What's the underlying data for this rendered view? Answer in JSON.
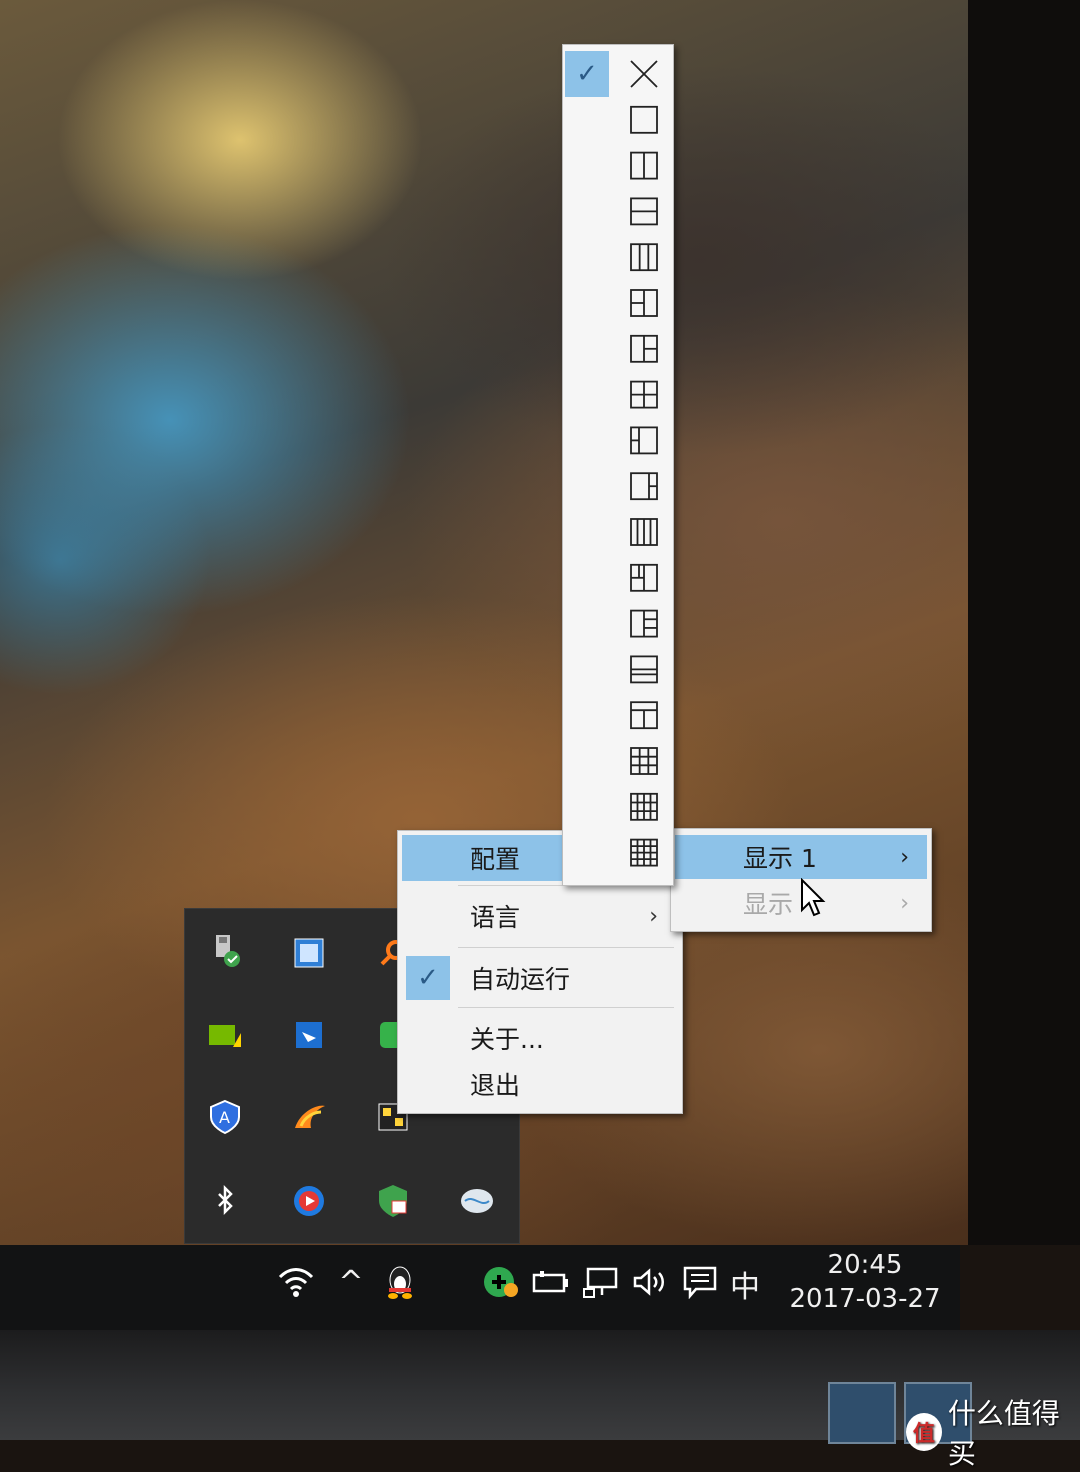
{
  "context_menu": {
    "items": [
      {
        "label": "配置",
        "has_submenu": true,
        "highlighted": true
      },
      {
        "label": "语言",
        "has_submenu": true
      },
      {
        "label": "自动运行",
        "checked": true
      },
      {
        "label": "关于..."
      },
      {
        "label": "退出"
      }
    ]
  },
  "submenu": {
    "items": [
      {
        "label": "显示 1",
        "highlighted": true
      },
      {
        "label": "显示",
        "disabled": true
      }
    ]
  },
  "layout_picker": {
    "selected_index": 0,
    "icon_names": [
      "close-layout-icon",
      "single-layout-icon",
      "two-columns-icon",
      "two-rows-icon",
      "three-columns-icon",
      "left-split-right-icon",
      "right-split-left-icon",
      "quad-grid-icon",
      "left-narrow-icon",
      "right-narrow-icon",
      "four-columns-icon",
      "grid-variant-a-icon",
      "grid-variant-b-icon",
      "bottom-row-icon",
      "top-row-icon",
      "grid-3x3-icon",
      "grid-4x3-icon",
      "grid-4x4-icon"
    ]
  },
  "taskbar": {
    "time": "20:45",
    "date": "2017-03-27",
    "ime": "中",
    "up_arrow": "^"
  },
  "watermark": {
    "text": "什么值得买",
    "badge": "值"
  }
}
